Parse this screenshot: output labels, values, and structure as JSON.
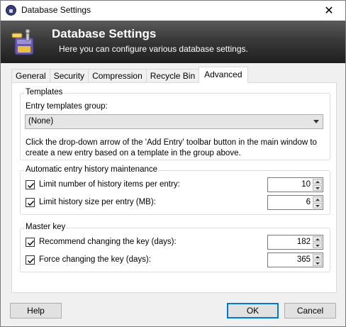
{
  "window": {
    "title": "Database Settings",
    "close_glyph": "✕"
  },
  "banner": {
    "title": "Database Settings",
    "subtitle": "Here you can configure various database settings."
  },
  "tabs": [
    {
      "label": "General",
      "active": false
    },
    {
      "label": "Security",
      "active": false
    },
    {
      "label": "Compression",
      "active": false
    },
    {
      "label": "Recycle Bin",
      "active": false
    },
    {
      "label": "Advanced",
      "active": true
    }
  ],
  "templates": {
    "group_label": "Templates",
    "field_label": "Entry templates group:",
    "selected": "(None)",
    "hint": "Click the drop-down arrow of the 'Add Entry' toolbar button in the main window to create a new entry based on a template in the group above."
  },
  "history": {
    "group_label": "Automatic entry history maintenance",
    "items": [
      {
        "label": "Limit number of history items per entry:",
        "checked": true,
        "value": "10"
      },
      {
        "label": "Limit history size per entry (MB):",
        "checked": true,
        "value": "6"
      }
    ]
  },
  "master_key": {
    "group_label": "Master key",
    "items": [
      {
        "label": "Recommend changing the key (days):",
        "checked": true,
        "value": "182"
      },
      {
        "label": "Force changing the key (days):",
        "checked": true,
        "value": "365"
      }
    ]
  },
  "buttons": {
    "help": "Help",
    "ok": "OK",
    "cancel": "Cancel"
  },
  "colors": {
    "accent": "#0078d7",
    "banner_dark": "#1e1e1e"
  }
}
